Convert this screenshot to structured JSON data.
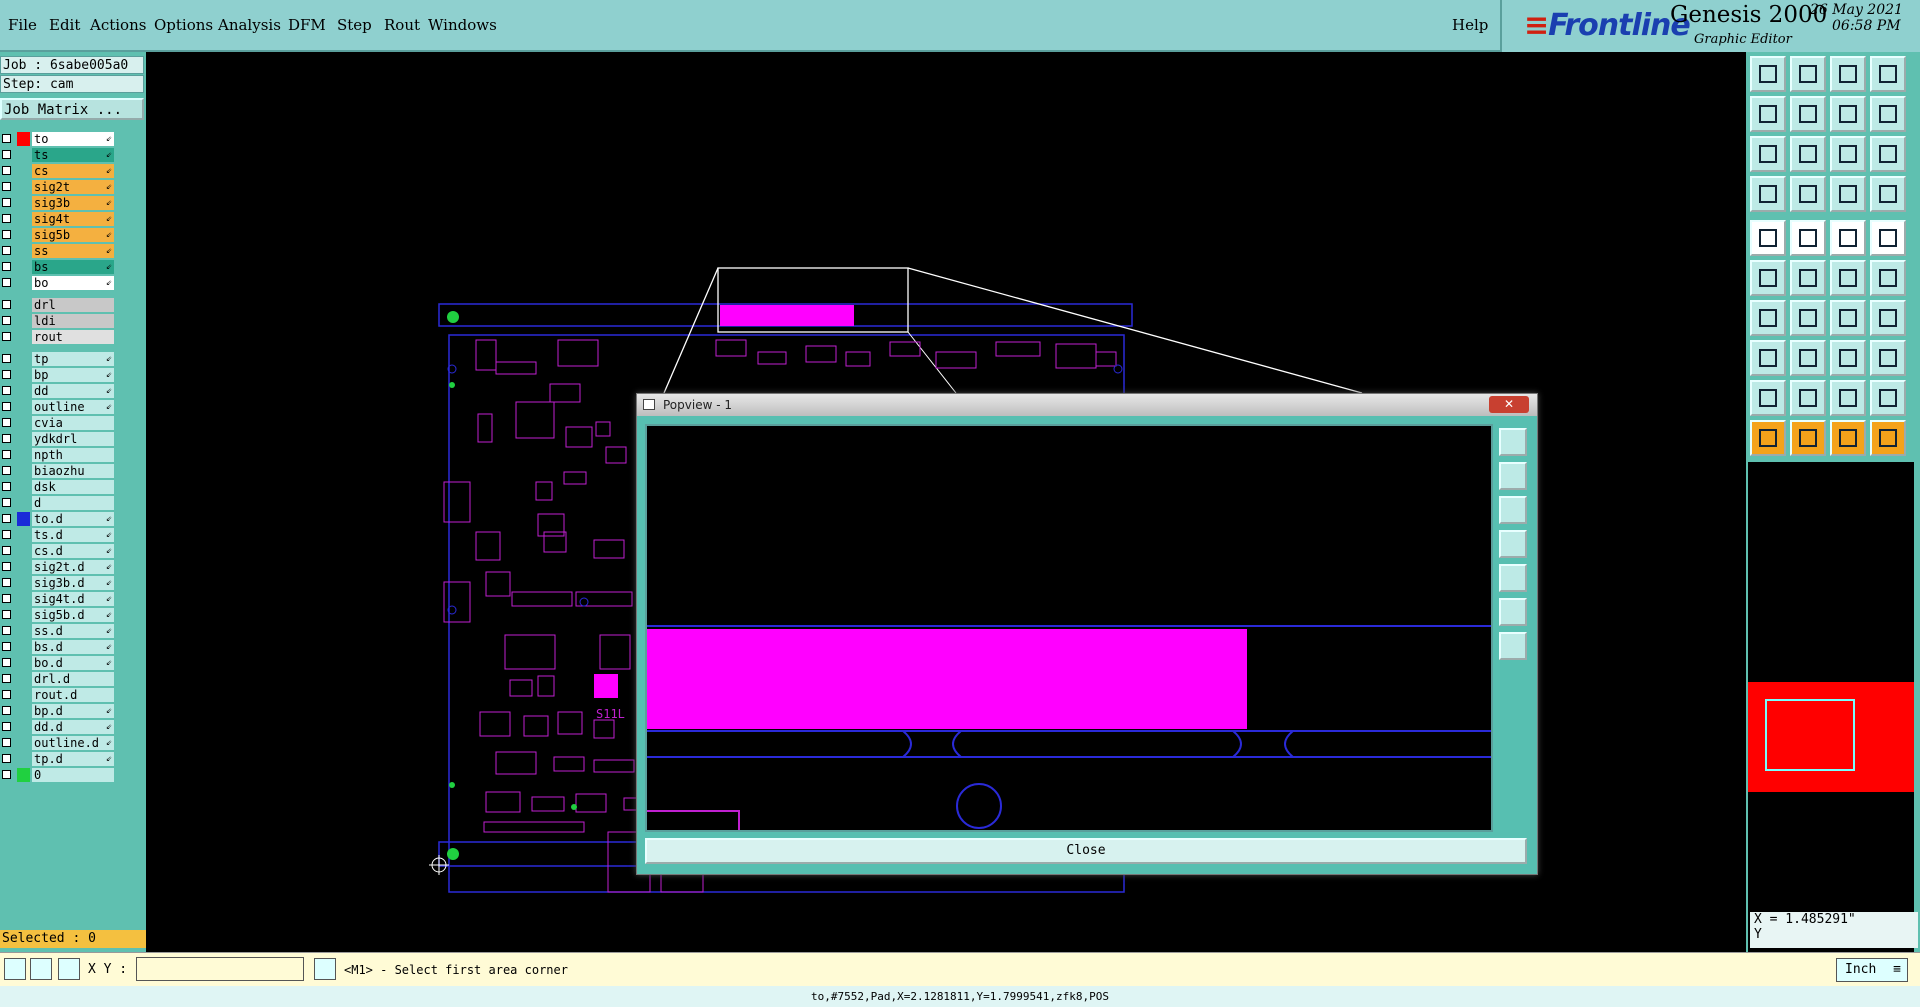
{
  "menu": {
    "items": [
      "File",
      "Edit",
      "Actions",
      "Options",
      "Analysis",
      "DFM",
      "Step",
      "Rout",
      "Windows"
    ],
    "help": "Help"
  },
  "brand": {
    "logo": "Frontline",
    "product": "Genesis 2000",
    "subtitle": "Graphic Editor",
    "date": "26 May 2021",
    "time": "06:58 PM"
  },
  "job": {
    "job_label": "Job : 6sabe005a0",
    "step_label": "Step: cam",
    "matrix_button": "Job Matrix ..."
  },
  "layers": [
    {
      "name": "to",
      "color": "#ffffff",
      "swatch": "#ff0000",
      "arrow": "⇙"
    },
    {
      "name": "ts",
      "color": "#2aa68a",
      "swatch": "",
      "arrow": "⇙"
    },
    {
      "name": "cs",
      "color": "#f4b040",
      "swatch": "",
      "arrow": "⇙"
    },
    {
      "name": "sig2t",
      "color": "#f4b040",
      "swatch": "",
      "arrow": "⇙"
    },
    {
      "name": "sig3b",
      "color": "#f4b040",
      "swatch": "",
      "arrow": "⇙"
    },
    {
      "name": "sig4t",
      "color": "#f4b040",
      "swatch": "",
      "arrow": "⇙"
    },
    {
      "name": "sig5b",
      "color": "#f4b040",
      "swatch": "",
      "arrow": "⇙"
    },
    {
      "name": "ss",
      "color": "#f4b040",
      "swatch": "",
      "arrow": "⇙"
    },
    {
      "name": "bs",
      "color": "#2aa68a",
      "swatch": "",
      "arrow": "⇙"
    },
    {
      "name": "bo",
      "color": "#ffffff",
      "swatch": "",
      "arrow": "⇙"
    },
    {
      "name": "drl",
      "color": "#c8c8c8",
      "swatch": "",
      "arrow": ""
    },
    {
      "name": "ldi",
      "color": "#c8c8c8",
      "swatch": "",
      "arrow": ""
    },
    {
      "name": "rout",
      "color": "#e0e0e0",
      "swatch": "",
      "arrow": ""
    },
    {
      "name": "tp",
      "color": "#bfeae6",
      "swatch": "",
      "arrow": "⇙"
    },
    {
      "name": "bp",
      "color": "#bfeae6",
      "swatch": "",
      "arrow": "⇙"
    },
    {
      "name": "dd",
      "color": "#bfeae6",
      "swatch": "",
      "arrow": "⇙"
    },
    {
      "name": "outline",
      "color": "#bfeae6",
      "swatch": "",
      "arrow": "⇙"
    },
    {
      "name": "cvia",
      "color": "#bfeae6",
      "swatch": "",
      "arrow": ""
    },
    {
      "name": "ydkdrl",
      "color": "#bfeae6",
      "swatch": "",
      "arrow": ""
    },
    {
      "name": "npth",
      "color": "#bfeae6",
      "swatch": "",
      "arrow": ""
    },
    {
      "name": "biaozhu",
      "color": "#bfeae6",
      "swatch": "",
      "arrow": ""
    },
    {
      "name": "dsk",
      "color": "#bfeae6",
      "swatch": "",
      "arrow": ""
    },
    {
      "name": "d",
      "color": "#bfeae6",
      "swatch": "",
      "arrow": ""
    },
    {
      "name": "to.d",
      "color": "#bfeae6",
      "swatch": "#1a2ad8",
      "arrow": "⇙"
    },
    {
      "name": "ts.d",
      "color": "#bfeae6",
      "swatch": "",
      "arrow": "⇙"
    },
    {
      "name": "cs.d",
      "color": "#bfeae6",
      "swatch": "",
      "arrow": "⇙"
    },
    {
      "name": "sig2t.d",
      "color": "#bfeae6",
      "swatch": "",
      "arrow": "⇙"
    },
    {
      "name": "sig3b.d",
      "color": "#bfeae6",
      "swatch": "",
      "arrow": "⇙"
    },
    {
      "name": "sig4t.d",
      "color": "#bfeae6",
      "swatch": "",
      "arrow": "⇙"
    },
    {
      "name": "sig5b.d",
      "color": "#bfeae6",
      "swatch": "",
      "arrow": "⇙"
    },
    {
      "name": "ss.d",
      "color": "#bfeae6",
      "swatch": "",
      "arrow": "⇙"
    },
    {
      "name": "bs.d",
      "color": "#bfeae6",
      "swatch": "",
      "arrow": "⇙"
    },
    {
      "name": "bo.d",
      "color": "#bfeae6",
      "swatch": "",
      "arrow": "⇙"
    },
    {
      "name": "drl.d",
      "color": "#bfeae6",
      "swatch": "",
      "arrow": ""
    },
    {
      "name": "rout.d",
      "color": "#bfeae6",
      "swatch": "",
      "arrow": ""
    },
    {
      "name": "bp.d",
      "color": "#bfeae6",
      "swatch": "",
      "arrow": "⇙"
    },
    {
      "name": "dd.d",
      "color": "#bfeae6",
      "swatch": "",
      "arrow": "⇙"
    },
    {
      "name": "outline.d",
      "color": "#bfeae6",
      "swatch": "",
      "arrow": "⇙"
    },
    {
      "name": "tp.d",
      "color": "#bfeae6",
      "swatch": "",
      "arrow": "⇙"
    },
    {
      "name": "0",
      "color": "#bfeae6",
      "swatch": "#20d040",
      "arrow": ""
    }
  ],
  "selected": "Selected : 0",
  "status": {
    "xy_label": "X Y :",
    "xy_value": "",
    "prompt": "<M1> - Select first area corner",
    "units": "Inch",
    "bottom_info": "to,#7552,Pad,X=2.1281811,Y=1.7999541,zfk8,POS"
  },
  "coord": {
    "x_text": "X = 1.485291\"",
    "y_text": "Y"
  },
  "popview": {
    "title": "Popview - 1",
    "close_label": "Close",
    "close_x": "✕"
  },
  "board": {
    "label": "S11L"
  },
  "colors": {
    "magenta": "#ff00ff",
    "board_line": "#2a2ad8",
    "highlight": "#ff0000"
  }
}
